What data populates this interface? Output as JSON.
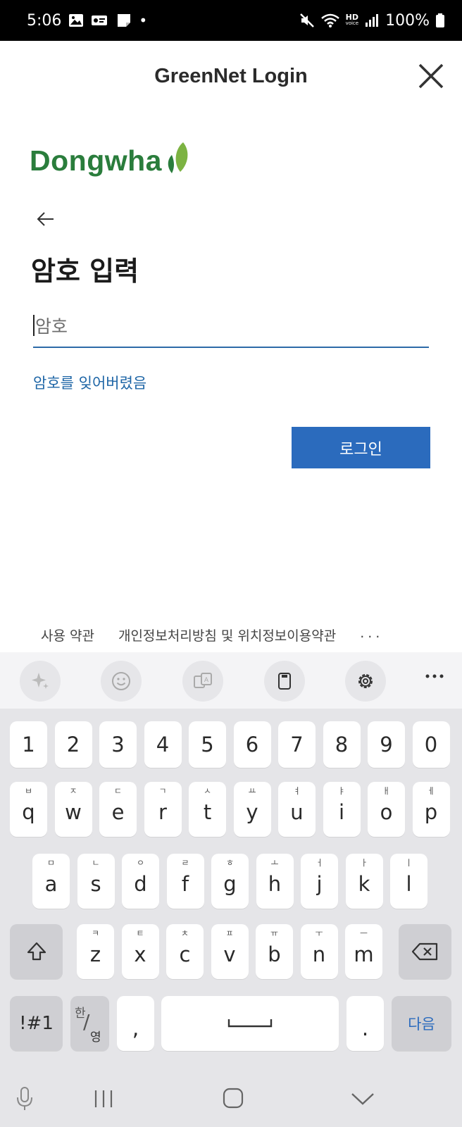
{
  "status_bar": {
    "time": "5:06",
    "battery": "100%",
    "hd_label": "HD",
    "hd_sub": "voice"
  },
  "header": {
    "title": "GreenNet Login"
  },
  "logo": {
    "text": "Dongwha"
  },
  "form": {
    "title": "암호 입력",
    "password_placeholder": "암호",
    "password_value": "",
    "forgot_link": "암호를 잊어버렸음",
    "login_button": "로그인"
  },
  "footer": {
    "terms": "사용 약관",
    "privacy": "개인정보처리방침 및 위치정보이용약관",
    "more": "..."
  },
  "keyboard": {
    "toolbar_icons": [
      "sparkle-icon",
      "emoji-icon",
      "translate-icon",
      "clipboard-icon",
      "gear-icon",
      "more-icon"
    ],
    "number_row": [
      "1",
      "2",
      "3",
      "4",
      "5",
      "6",
      "7",
      "8",
      "9",
      "0"
    ],
    "row1": [
      {
        "key": "q",
        "hint": "ㅂ"
      },
      {
        "key": "w",
        "hint": "ㅈ"
      },
      {
        "key": "e",
        "hint": "ㄷ"
      },
      {
        "key": "r",
        "hint": "ㄱ"
      },
      {
        "key": "t",
        "hint": "ㅅ"
      },
      {
        "key": "y",
        "hint": "ㅛ"
      },
      {
        "key": "u",
        "hint": "ㅕ"
      },
      {
        "key": "i",
        "hint": "ㅑ"
      },
      {
        "key": "o",
        "hint": "ㅐ"
      },
      {
        "key": "p",
        "hint": "ㅔ"
      }
    ],
    "row2": [
      {
        "key": "a",
        "hint": "ㅁ"
      },
      {
        "key": "s",
        "hint": "ㄴ"
      },
      {
        "key": "d",
        "hint": "ㅇ"
      },
      {
        "key": "f",
        "hint": "ㄹ"
      },
      {
        "key": "g",
        "hint": "ㅎ"
      },
      {
        "key": "h",
        "hint": "ㅗ"
      },
      {
        "key": "j",
        "hint": "ㅓ"
      },
      {
        "key": "k",
        "hint": "ㅏ"
      },
      {
        "key": "l",
        "hint": "ㅣ"
      }
    ],
    "row3": [
      {
        "key": "z",
        "hint": "ㅋ"
      },
      {
        "key": "x",
        "hint": "ㅌ"
      },
      {
        "key": "c",
        "hint": "ㅊ"
      },
      {
        "key": "v",
        "hint": "ㅍ"
      },
      {
        "key": "b",
        "hint": "ㅠ"
      },
      {
        "key": "n",
        "hint": "ㅜ"
      },
      {
        "key": "m",
        "hint": "ㅡ"
      }
    ],
    "symbols_key": "!#1",
    "lang_key_top": "한",
    "lang_key_bottom": "영",
    "comma_key": ",",
    "period_key": ".",
    "next_key": "다음"
  },
  "colors": {
    "brand_green": "#2a7d3c",
    "link_blue": "#1d65a6",
    "button_blue": "#2b6bbd"
  }
}
